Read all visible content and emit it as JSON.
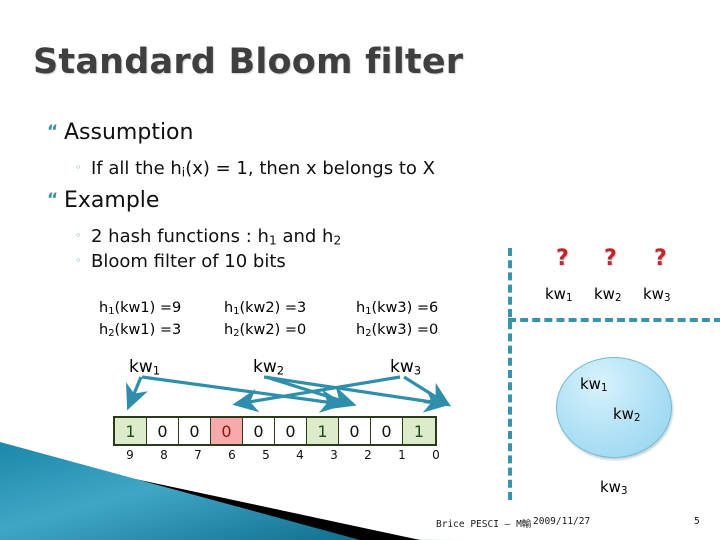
{
  "slide": {
    "title": "Standard Bloom filter",
    "bullets": [
      {
        "level": 1,
        "text": "Assumption"
      },
      {
        "level": 2,
        "text": "If all the hi(x) = 1, then x belongs to X"
      },
      {
        "level": 1,
        "text": "Example"
      },
      {
        "level": 2,
        "text": "2 hash functions : h1 and h2"
      },
      {
        "level": 2,
        "text": "Bloom filter of 10 bits"
      }
    ],
    "bullet_markers": {
      "level1": "“",
      "level2": "◦"
    }
  },
  "hash_groups": [
    {
      "line1_fn": "h",
      "line1_sub": "1",
      "line1_arg": "(kw1)",
      "line1_val": "=9",
      "line2_fn": "h",
      "line2_sub": "2",
      "line2_arg": "(kw1)",
      "line2_val": "=3"
    },
    {
      "line1_fn": "h",
      "line1_sub": "1",
      "line1_arg": "(kw2)",
      "line1_val": "=3",
      "line2_fn": "h",
      "line2_sub": "2",
      "line2_arg": "(kw2)",
      "line2_val": "=0"
    },
    {
      "line1_fn": "h",
      "line1_sub": "1",
      "line1_arg": "(kw3)",
      "line1_val": "=6",
      "line2_fn": "h",
      "line2_sub": "2",
      "line2_arg": "(kw3)",
      "line2_val": "=0"
    }
  ],
  "arrow_labels": [
    {
      "base": "kw",
      "sub": "1"
    },
    {
      "base": "kw",
      "sub": "2"
    },
    {
      "base": "kw",
      "sub": "3"
    }
  ],
  "bit_array": {
    "bits": [
      "1",
      "0",
      "0",
      "0",
      "0",
      "0",
      "1",
      "0",
      "0",
      "1"
    ],
    "indices": [
      "9",
      "8",
      "7",
      "6",
      "5",
      "4",
      "3",
      "2",
      "1",
      "0"
    ],
    "states": [
      "on",
      "off",
      "off",
      "hot",
      "off",
      "off",
      "on",
      "off",
      "off",
      "on"
    ]
  },
  "query_panel": {
    "question_mark": "?",
    "keywords": [
      {
        "base": "kw",
        "sub": "1"
      },
      {
        "base": "kw",
        "sub": "2"
      },
      {
        "base": "kw",
        "sub": "3"
      }
    ]
  },
  "set_circle": {
    "inside": [
      {
        "base": "kw",
        "sub": "1"
      },
      {
        "base": "kw",
        "sub": "2"
      }
    ],
    "outside": {
      "base": "kw",
      "sub": "3"
    }
  },
  "footer": {
    "author": "Brice PESCI – M輸",
    "date": "2009/11/27",
    "page": "5"
  },
  "colors": {
    "accent_teal": "#3a93ad",
    "title_gray": "#3f3f3f",
    "bit_on": "#dceccb",
    "bit_hot": "#f8a9a9",
    "question_red": "#c0272d",
    "circle_blue": "#aee0f5"
  }
}
